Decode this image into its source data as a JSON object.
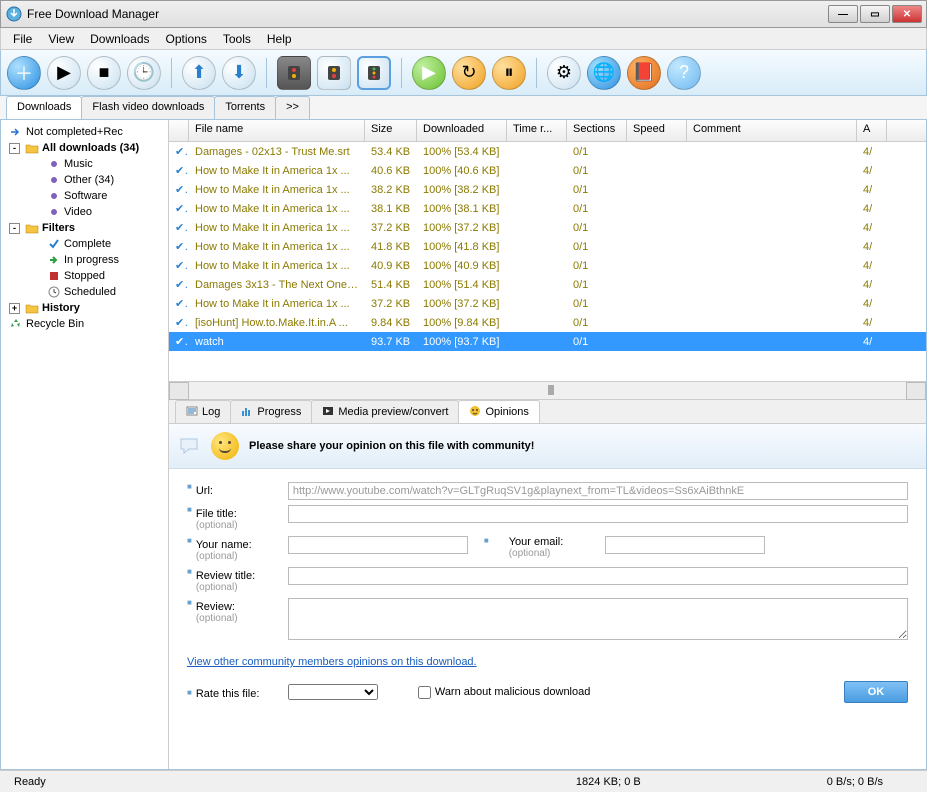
{
  "window": {
    "title": "Free Download Manager"
  },
  "menu": [
    "File",
    "View",
    "Downloads",
    "Options",
    "Tools",
    "Help"
  ],
  "tabs": {
    "items": [
      "Downloads",
      "Flash video downloads",
      "Torrents",
      ">>"
    ],
    "active": 0
  },
  "tree": {
    "items": [
      {
        "lvl": 0,
        "icon": "arrow-blue",
        "label": "Not completed+Rec"
      },
      {
        "lvl": 0,
        "icon": "folder",
        "label": "All downloads (34)",
        "bold": true,
        "expander": "-"
      },
      {
        "lvl": 2,
        "icon": "dot-purple",
        "label": "Music"
      },
      {
        "lvl": 2,
        "icon": "dot-purple",
        "label": "Other (34)"
      },
      {
        "lvl": 2,
        "icon": "dot-purple",
        "label": "Software"
      },
      {
        "lvl": 2,
        "icon": "dot-purple",
        "label": "Video"
      },
      {
        "lvl": 0,
        "icon": "folder",
        "label": "Filters",
        "bold": true,
        "expander": "-"
      },
      {
        "lvl": 2,
        "icon": "check",
        "label": "Complete"
      },
      {
        "lvl": 2,
        "icon": "arrow-green",
        "label": "In progress"
      },
      {
        "lvl": 2,
        "icon": "stop",
        "label": "Stopped"
      },
      {
        "lvl": 2,
        "icon": "clock",
        "label": "Scheduled"
      },
      {
        "lvl": 0,
        "icon": "folder",
        "label": "History",
        "bold": true,
        "expander": "+"
      },
      {
        "lvl": 0,
        "icon": "recycle",
        "label": "Recycle Bin"
      }
    ]
  },
  "grid": {
    "columns": [
      "",
      "File name",
      "Size",
      "Downloaded",
      "Time r...",
      "Sections",
      "Speed",
      "Comment",
      "A"
    ],
    "rows": [
      {
        "file": "Damages - 02x13 - Trust Me.srt",
        "size": "53.4 KB",
        "dl": "100% [53.4 KB]",
        "sec": "0/1",
        "a": "4/"
      },
      {
        "file": "How to Make It in America 1x ...",
        "size": "40.6 KB",
        "dl": "100% [40.6 KB]",
        "sec": "0/1",
        "a": "4/"
      },
      {
        "file": "How to Make It in America 1x ...",
        "size": "38.2 KB",
        "dl": "100% [38.2 KB]",
        "sec": "0/1",
        "a": "4/"
      },
      {
        "file": "How to Make It in America 1x ...",
        "size": "38.1 KB",
        "dl": "100% [38.1 KB]",
        "sec": "0/1",
        "a": "4/"
      },
      {
        "file": "How to Make It in America 1x ...",
        "size": "37.2 KB",
        "dl": "100% [37.2 KB]",
        "sec": "0/1",
        "a": "4/"
      },
      {
        "file": "How to Make It in America 1x ...",
        "size": "41.8 KB",
        "dl": "100% [41.8 KB]",
        "sec": "0/1",
        "a": "4/"
      },
      {
        "file": "How to Make It in America 1x ...",
        "size": "40.9 KB",
        "dl": "100% [40.9 KB]",
        "sec": "0/1",
        "a": "4/"
      },
      {
        "file": "Damages 3x13 - The Next One ...",
        "size": "51.4 KB",
        "dl": "100% [51.4 KB]",
        "sec": "0/1",
        "a": "4/"
      },
      {
        "file": "How to Make It in America 1x ...",
        "size": "37.2 KB",
        "dl": "100% [37.2 KB]",
        "sec": "0/1",
        "a": "4/"
      },
      {
        "file": "[isoHunt] How.to.Make.It.in.A ...",
        "size": "9.84 KB",
        "dl": "100% [9.84 KB]",
        "sec": "0/1",
        "a": "4/"
      },
      {
        "file": "watch",
        "size": "93.7 KB",
        "dl": "100% [93.7 KB]",
        "sec": "0/1",
        "a": "4/",
        "sel": true
      }
    ]
  },
  "detailTabs": {
    "items": [
      "Log",
      "Progress",
      "Media preview/convert",
      "Opinions"
    ],
    "active": 3
  },
  "opinions": {
    "header": "Please share your opinion on this file with community!",
    "url_label": "Url:",
    "url_value": "http://www.youtube.com/watch?v=GLTgRuqSV1g&playnext_from=TL&videos=Ss6xAiBthnkE",
    "file_title_label": "File title:",
    "your_name_label": "Your name:",
    "your_email_label": "Your email:",
    "review_title_label": "Review title:",
    "review_label": "Review:",
    "optional": "(optional)",
    "link": "View other community members opinions on this download.",
    "rate_label": "Rate this file:",
    "warn_label": "Warn about malicious download",
    "ok": "OK"
  },
  "status": {
    "ready": "Ready",
    "mid": "1824 KB; 0 B",
    "right": "0 B/s; 0 B/s"
  }
}
